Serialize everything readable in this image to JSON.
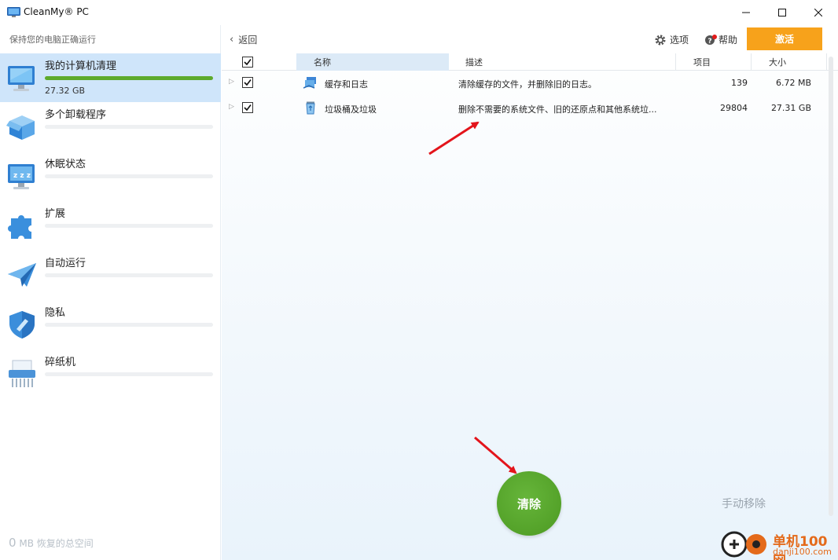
{
  "window": {
    "title": "CleanMy® PC",
    "icon": "monitor-icon"
  },
  "sidebar": {
    "subtitle": "保持您的电脑正确运行",
    "items": [
      {
        "label": "我的计算机清理",
        "size": "27.32 GB",
        "progress": 1.0,
        "icon": "computer-icon",
        "active": true
      },
      {
        "label": "多个卸载程序",
        "icon": "box-icon"
      },
      {
        "label": "休眠状态",
        "icon": "sleep-monitor-icon"
      },
      {
        "label": "扩展",
        "icon": "puzzle-icon"
      },
      {
        "label": "自动运行",
        "icon": "paper-plane-icon"
      },
      {
        "label": "隐私",
        "icon": "shield-icon"
      },
      {
        "label": "碎纸机",
        "icon": "shredder-icon"
      }
    ],
    "recovered_num": "0",
    "recovered_text": "MB 恢复的总空间"
  },
  "toolbar": {
    "back": "返回",
    "options": "选项",
    "help": "帮助",
    "activate": "激活"
  },
  "table": {
    "columns": {
      "name": "名称",
      "desc": "描述",
      "count": "项目",
      "size": "大小"
    },
    "rows": [
      {
        "name": "缓存和日志",
        "desc": "清除缓存的文件，并删除旧的日志。",
        "count": "139",
        "size": "6.72 MB",
        "icon": "cache-icon"
      },
      {
        "name": "垃圾桶及垃圾",
        "desc": "删除不需要的系统文件、旧的还原点和其他系统垃...",
        "count": "29804",
        "size": "27.31 GB",
        "icon": "recycle-bin-icon"
      }
    ]
  },
  "actions": {
    "clean": "清除",
    "manual": "手动移除"
  },
  "watermark": {
    "text": "单机100网",
    "url": "danji100.com"
  },
  "colors": {
    "accent_orange": "#f7a21b",
    "clean_green": "#5daa2c",
    "active_bg": "#cfe5fa",
    "arrow_red": "#e3141b"
  }
}
